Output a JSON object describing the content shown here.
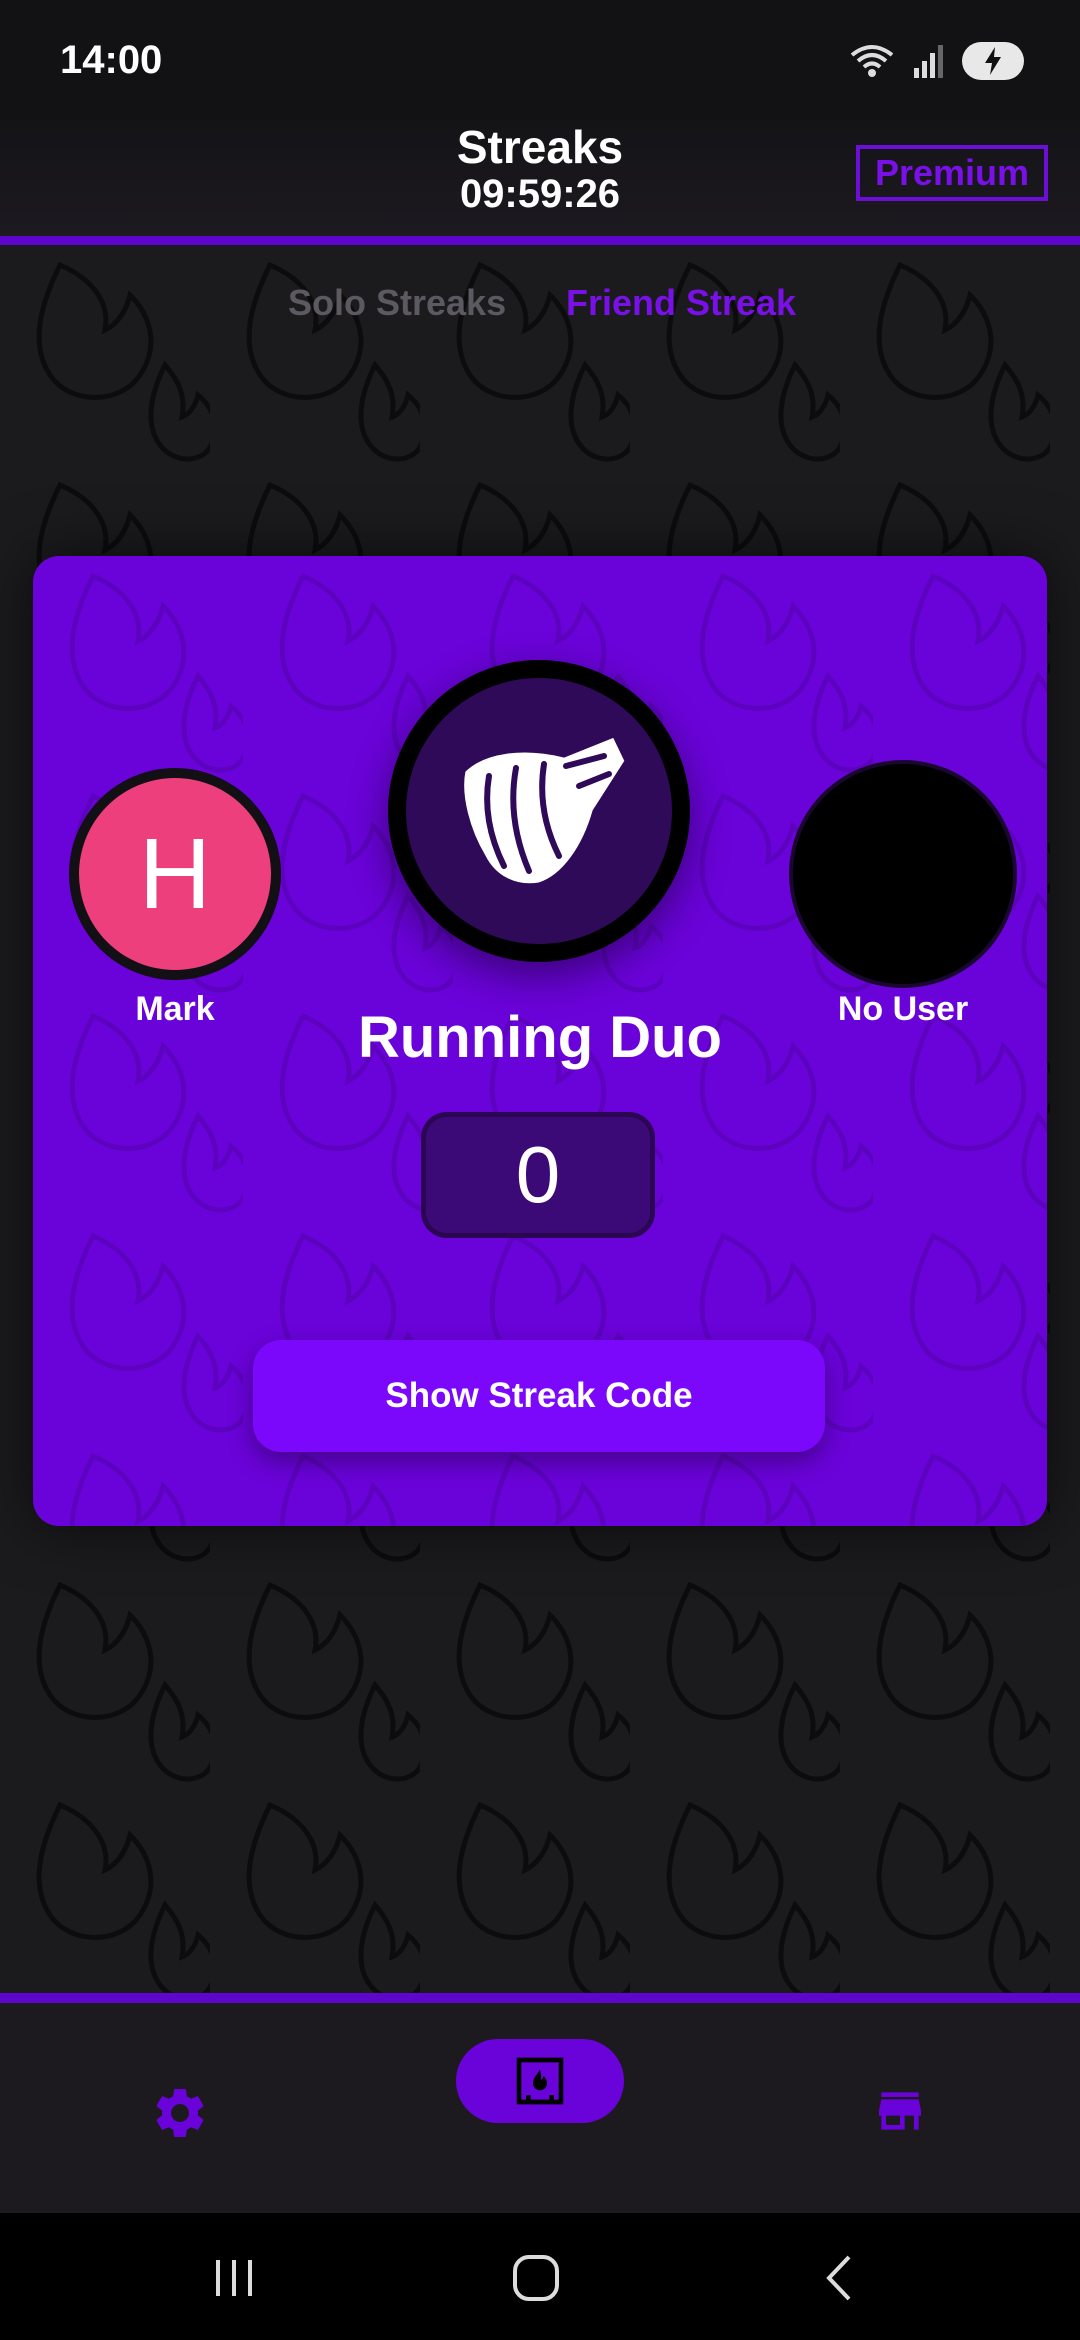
{
  "status_bar": {
    "time": "14:00"
  },
  "header": {
    "title": "Streaks",
    "timer": "09:59:26",
    "premium_label": "Premium"
  },
  "tabs": [
    {
      "label": "Solo Streaks",
      "active": false
    },
    {
      "label": "Friend Streak",
      "active": true
    }
  ],
  "streak_card": {
    "left_user": {
      "initial": "H",
      "name": "Mark"
    },
    "right_user": {
      "name": "No User"
    },
    "streak_name": "Running Duo",
    "streak_count": "0",
    "show_code_label": "Show Streak Code"
  },
  "bottom_nav": {
    "items": [
      {
        "icon": "gear-icon"
      },
      {
        "icon": "fireplace-icon",
        "selected": true
      },
      {
        "icon": "store-icon"
      }
    ]
  },
  "colors": {
    "accent": "#6a03d9",
    "accent_bright": "#7b08fb",
    "avatar": "#ec3f7c",
    "background": "#1b1a1d"
  }
}
